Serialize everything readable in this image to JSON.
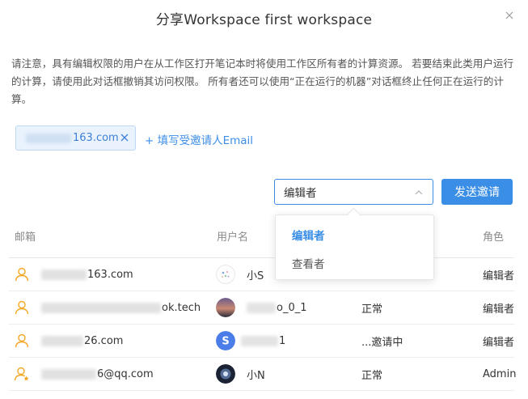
{
  "dialog": {
    "title": "分享Workspace first workspace",
    "notice": "请注意，具有编辑权限的用户在从工作区打开笔记本时将使用工作区所有者的计算资源。 若要结束此类用户运行的计算，请使用此对话框撤销其访问权限。 所有者还可以使用“正在运行的机器”对话框终止任何正在运行的计算。"
  },
  "invite": {
    "chip_email_visible": "163.com",
    "add_email_label": "+ 填写受邀请人Email"
  },
  "role_select": {
    "value": "编辑者",
    "options": [
      "编辑者",
      "查看者"
    ],
    "selected_index": 0
  },
  "send_button": "发送邀请",
  "table": {
    "headers": {
      "email": "邮箱",
      "username": "用户名",
      "role": "角色"
    },
    "rows": [
      {
        "email": "163.com",
        "name": "小S",
        "status": "",
        "role": "编辑者",
        "owner": false
      },
      {
        "email": "ok.tech",
        "name": "o_0_1",
        "status": "正常",
        "role": "编辑者",
        "owner": false
      },
      {
        "email": "26.com",
        "name": "1",
        "status": "...邀请中",
        "role": "编辑者",
        "owner": false
      },
      {
        "email": "6@qq.com",
        "name": "小N",
        "status": "正常",
        "role": "Admin",
        "owner": true
      }
    ]
  },
  "colors": {
    "accent": "#3a8ee6",
    "chip_bg": "#eaf3fd",
    "user_icon": "#f5a623"
  },
  "icons": {
    "close": "close-icon",
    "chip_close": "close-icon",
    "chevron": "chevron-up-icon",
    "user": "user-icon",
    "owner": "user-star-icon"
  }
}
